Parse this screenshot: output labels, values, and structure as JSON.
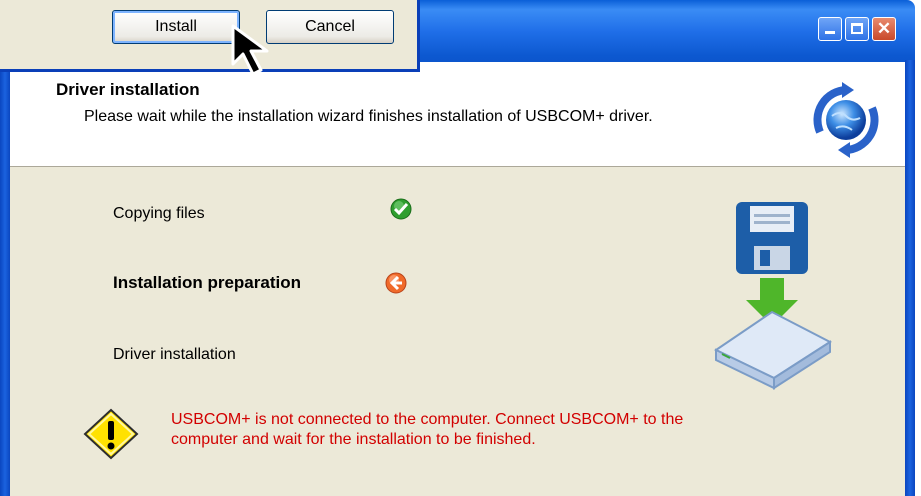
{
  "dialog": {
    "install_label": "Install",
    "cancel_label": "Cancel"
  },
  "wizard": {
    "window_buttons": [
      "minimize-icon",
      "maximize-icon",
      "close-icon"
    ],
    "close_glyph": "✕",
    "header": {
      "title": "Driver installation",
      "subtitle": "Please wait while the installation wizard finishes installation of USBCOM+ driver."
    },
    "steps": [
      {
        "label": "Copying files",
        "status": "done"
      },
      {
        "label": "Installation preparation",
        "status": "current"
      },
      {
        "label": "Driver installation",
        "status": "pending"
      }
    ],
    "warning": "USBCOM+ is not connected to the computer. Connect USBCOM+ to the computer and wait for the installation to be finished."
  },
  "colors": {
    "title_bar": "#0c58d0",
    "content_bg": "#ece9d8",
    "warning_text": "#d20000",
    "ok_green": "#2f9e2f",
    "current_orange": "#f06a2a"
  }
}
